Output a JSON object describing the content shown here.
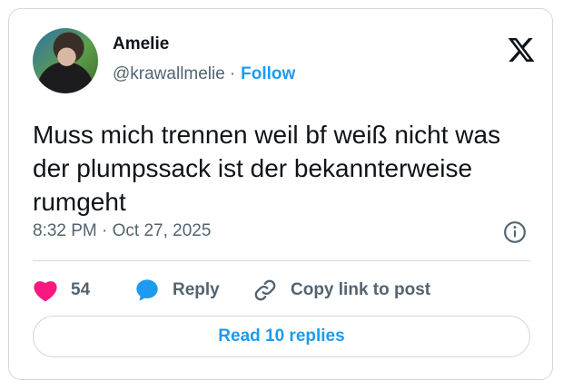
{
  "author": {
    "name": "Amelie",
    "handle": "@krawallmelie",
    "separator": "·",
    "follow_label": "Follow"
  },
  "logo_icon": "x-logo-icon",
  "tweet": {
    "text": "Muss mich trennen weil bf weiß nicht was der plumpssack ist der bekannterweise rumgeht",
    "timestamp": "8:32 PM · Oct 27, 2025"
  },
  "actions": {
    "like_count": "54",
    "reply_label": "Reply",
    "copy_label": "Copy link to post"
  },
  "read_replies_label": "Read 10 replies",
  "colors": {
    "accent": "#1d9bf0",
    "like": "#f91880",
    "text": "#0f1419",
    "muted": "#536471",
    "border": "#cfd9de"
  }
}
